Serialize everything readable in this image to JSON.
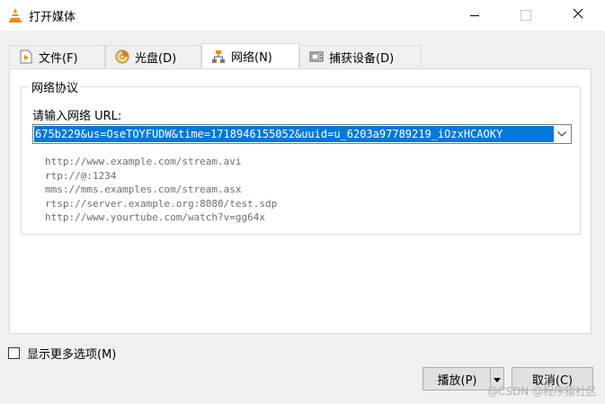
{
  "window": {
    "title": "打开媒体",
    "icons": {
      "app": "vlc-cone-icon",
      "minimize": "minimize-icon",
      "maximize": "maximize-icon",
      "close": "close-icon"
    }
  },
  "tabs": [
    {
      "label": "文件(F)",
      "icon": "file-icon"
    },
    {
      "label": "光盘(D)",
      "icon": "disc-icon"
    },
    {
      "label": "网络(N)",
      "icon": "network-icon",
      "active": true
    },
    {
      "label": "捕获设备(D)",
      "icon": "capture-device-icon"
    }
  ],
  "network": {
    "group_title": "网络协议",
    "url_label": "请输入网络 URL:",
    "url_value": "675b229&us=OseTOYFUDW&time=1718946155052&uuid=u_6203a97789219_iOzxHCAOKY",
    "examples": [
      "http://www.example.com/stream.avi",
      "rtp://@:1234",
      "mms://mms.examples.com/stream.asx",
      "rtsp://server.example.org:8080/test.sdp",
      "http://www.yourtube.com/watch?v=gg64x"
    ]
  },
  "footer": {
    "more_options": "显示更多选项(M)",
    "play": "播放(P)",
    "cancel": "取消(C)",
    "watermark": "@CSDN @程序猿社区"
  },
  "colors": {
    "selection": "#0078d7",
    "accent_cone": "#f28b00"
  }
}
